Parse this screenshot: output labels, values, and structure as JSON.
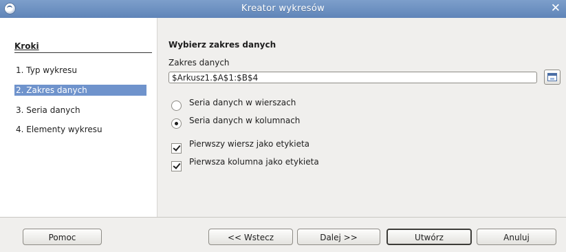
{
  "window": {
    "title": "Kreator wykresów"
  },
  "steps": {
    "header": "Kroki",
    "items": [
      {
        "label": "1. Typ wykresu",
        "selected": false
      },
      {
        "label": "2. Zakres danych",
        "selected": true
      },
      {
        "label": "3. Seria danych",
        "selected": false
      },
      {
        "label": "4. Elementy wykresu",
        "selected": false
      }
    ]
  },
  "main": {
    "title": "Wybierz zakres danych",
    "range_label": "Zakres danych",
    "range_value": "$Arkusz1.$A$1:$B$4",
    "options": [
      {
        "label": "Seria danych w wierszach",
        "type": "radio",
        "checked": false
      },
      {
        "label": "Seria danych w kolumnach",
        "type": "radio",
        "checked": true
      },
      {
        "label": "Pierwszy wiersz jako etykieta",
        "type": "checkbox",
        "checked": true
      },
      {
        "label": "Pierwsza kolumna jako etykieta",
        "type": "checkbox",
        "checked": true
      }
    ]
  },
  "buttons": {
    "help": "Pomoc",
    "back": "<< Wstecz",
    "next": "Dalej >>",
    "finish": "Utwórz",
    "cancel": "Anuluj"
  },
  "colors": {
    "titlebar": "#6b8fc0",
    "selection": "#6f93cc",
    "window_bg": "#f0efed"
  },
  "icons": {
    "app": "app-icon",
    "close": "close-icon",
    "range_shrink": "shrink-dialog-icon"
  }
}
